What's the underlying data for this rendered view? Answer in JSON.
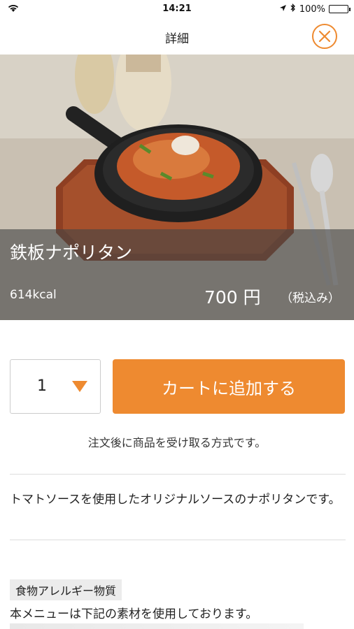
{
  "status_bar": {
    "time": "14:21",
    "battery": "100%"
  },
  "nav": {
    "title": "詳細",
    "close_icon": "close-circle-icon"
  },
  "item": {
    "name": "鉄板ナポリタン",
    "calories": "614kcal",
    "price": "700 円",
    "tax_note": "（税込み）"
  },
  "order": {
    "quantity": "1",
    "add_to_cart_label": "カートに追加する",
    "note": "注文後に商品を受け取る方式です。"
  },
  "description": "トマトソースを使用したオリジナルソースのナポリタンです。",
  "allergen": {
    "title": "食物アレルギー物質",
    "text": "本メニューは下記の素材を使用しております。"
  },
  "colors": {
    "accent": "#ee8a30"
  }
}
